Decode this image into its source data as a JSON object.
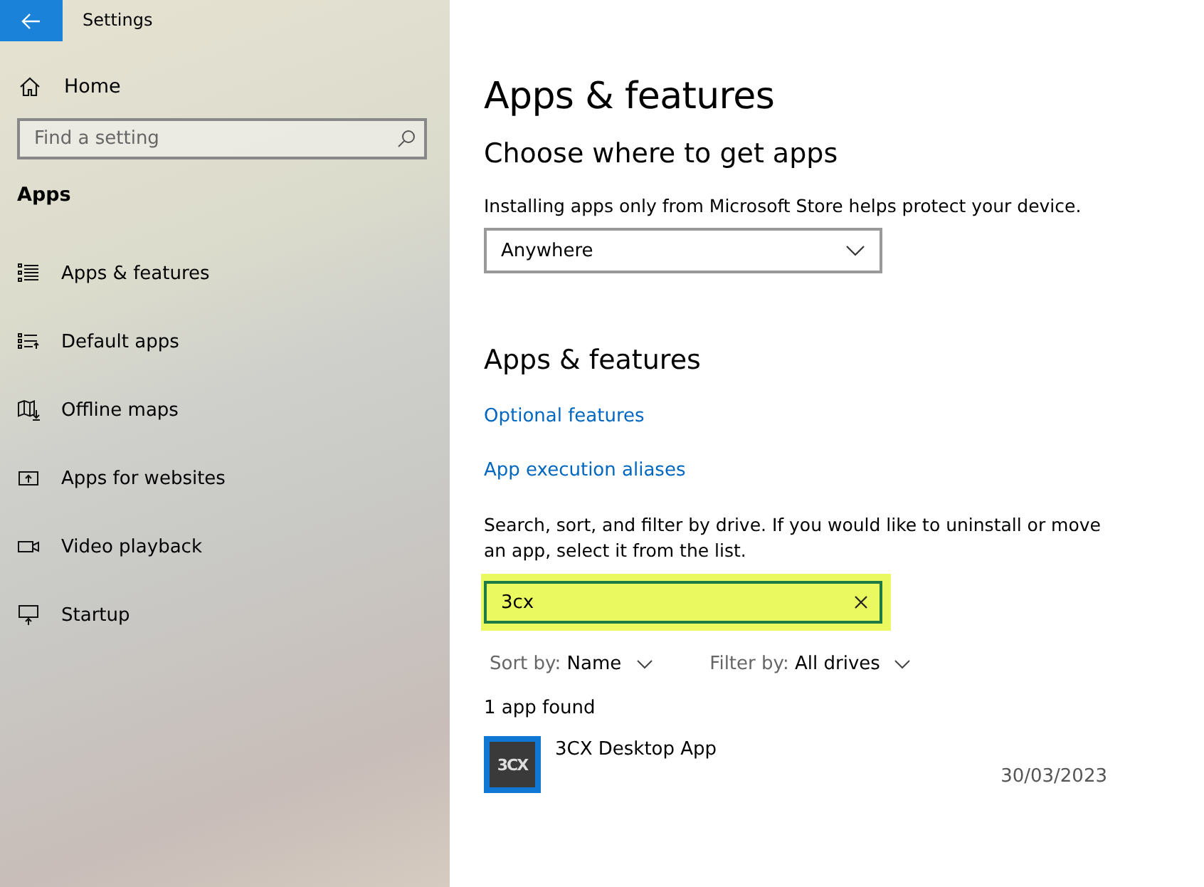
{
  "window": {
    "title": "Settings"
  },
  "sidebar": {
    "home": "Home",
    "search": {
      "placeholder": "Find a setting"
    },
    "section": "Apps",
    "items": [
      {
        "label": "Apps & features",
        "selected": false
      },
      {
        "label": "Default apps",
        "selected": false
      },
      {
        "label": "Offline maps",
        "selected": false
      },
      {
        "label": "Apps for websites",
        "selected": false
      },
      {
        "label": "Video playback",
        "selected": false
      },
      {
        "label": "Startup",
        "selected": false
      }
    ]
  },
  "main": {
    "title": "Apps & features",
    "where": {
      "heading": "Choose where to get apps",
      "text": "Installing apps only from Microsoft Store helps protect your device.",
      "dropdown": "Anywhere"
    },
    "features": {
      "heading": "Apps & features",
      "links": [
        "Optional features",
        "App execution aliases"
      ],
      "description": "Search, sort, and filter by drive. If you would like to uninstall or move an app, select it from the list.",
      "search": {
        "value": "3cx",
        "highlighted": true
      },
      "sort": {
        "label": "Sort by:",
        "value": "Name"
      },
      "filter": {
        "label": "Filter by:",
        "value": "All drives"
      },
      "count": "1 app found",
      "apps": [
        {
          "name": "3CX Desktop App",
          "icon_text": "3CX",
          "date": "30/03/2023"
        }
      ]
    }
  }
}
